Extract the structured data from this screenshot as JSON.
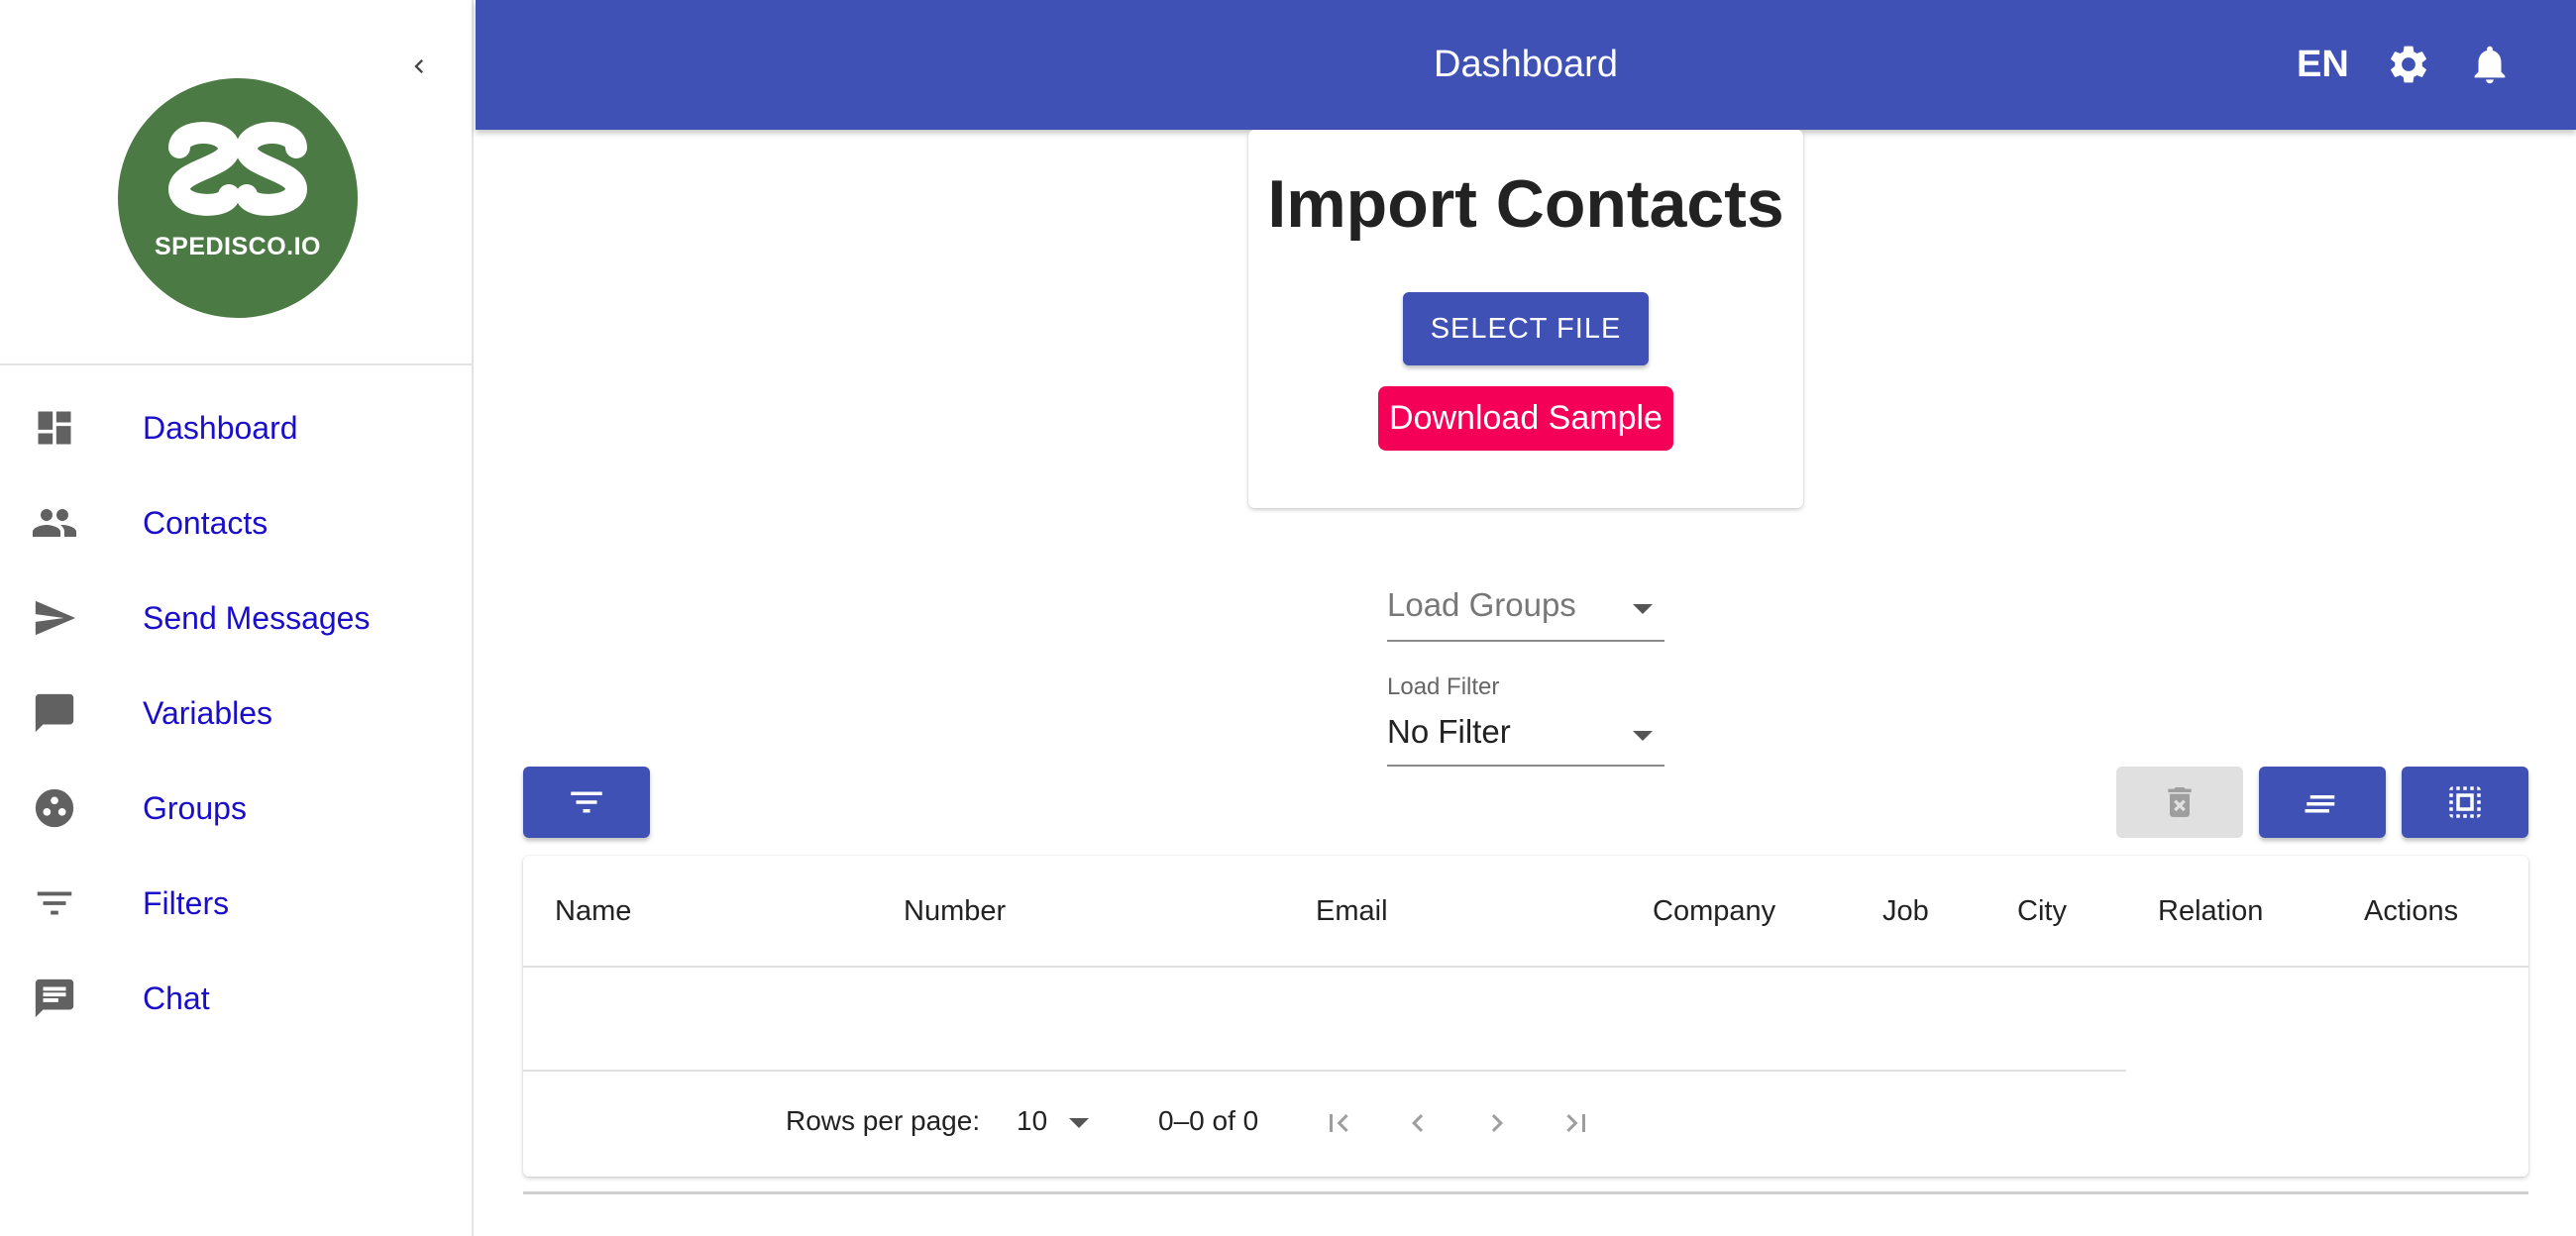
{
  "sidebar": {
    "logo_text": "SPEDISCO.IO",
    "items": [
      {
        "label": "Dashboard",
        "icon": "dashboard-icon"
      },
      {
        "label": "Contacts",
        "icon": "people-icon"
      },
      {
        "label": "Send Messages",
        "icon": "send-icon"
      },
      {
        "label": "Variables",
        "icon": "chat-bubble-icon"
      },
      {
        "label": "Groups",
        "icon": "groups-icon"
      },
      {
        "label": "Filters",
        "icon": "filter-icon"
      },
      {
        "label": "Chat",
        "icon": "message-icon"
      }
    ]
  },
  "appbar": {
    "title": "Dashboard",
    "language": "EN"
  },
  "import": {
    "title": "Import Contacts",
    "select_file_label": "SELECT FILE",
    "download_sample_label": "Download Sample"
  },
  "load_groups": {
    "placeholder": "Load Groups"
  },
  "load_filter": {
    "label": "Load Filter",
    "value": "No Filter"
  },
  "table": {
    "columns": [
      "Name",
      "Number",
      "Email",
      "Company",
      "Job",
      "City",
      "Relation",
      "Actions"
    ],
    "rows_per_page_label": "Rows per page:",
    "rows_per_page_value": "10",
    "range_text": "0–0 of 0"
  },
  "colors": {
    "primary": "#3f51b5",
    "secondary": "#f50057",
    "logo_green": "#4b7a44",
    "nav_link": "#1a0dcc"
  }
}
